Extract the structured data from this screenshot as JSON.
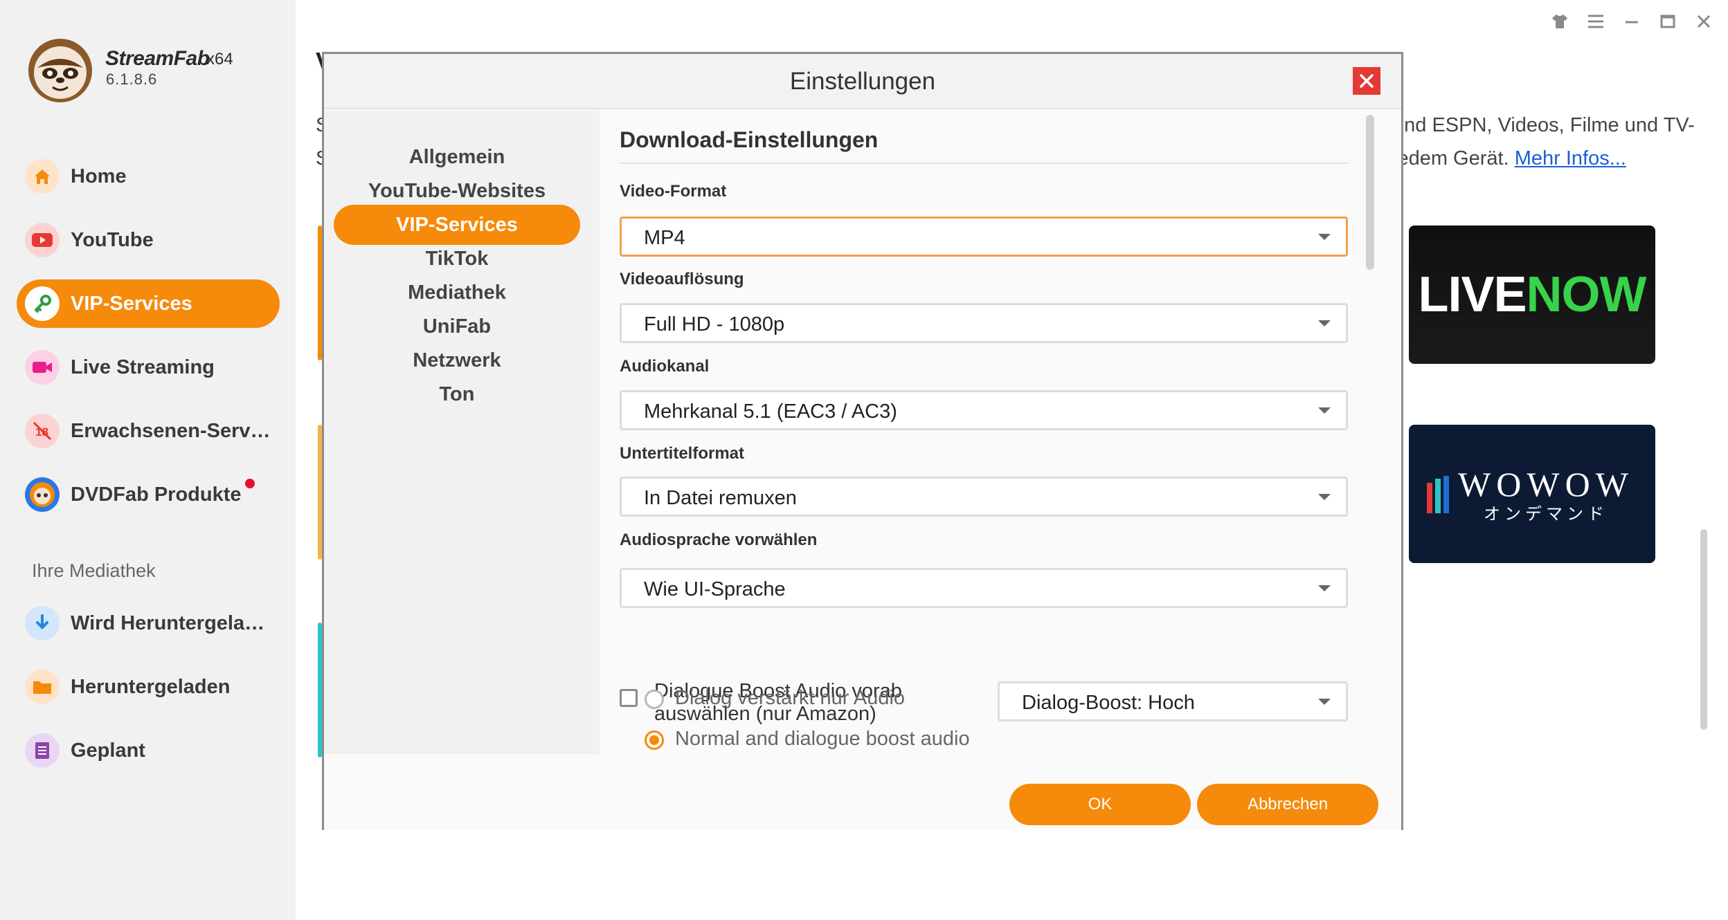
{
  "app": {
    "name": "StreamFab",
    "arch": "x64",
    "version": "6.1.8.6"
  },
  "sidebar": {
    "items": [
      {
        "label": "Home",
        "icon": "home-icon",
        "color": "#f58a0b"
      },
      {
        "label": "YouTube",
        "icon": "youtube-icon",
        "color": "#e53935"
      },
      {
        "label": "VIP-Services",
        "icon": "key-icon",
        "color": "#2e9e3e",
        "active": true
      },
      {
        "label": "Live Streaming",
        "icon": "camera-icon",
        "color": "#e91e8c"
      },
      {
        "label": "Erwachsenen-Serv…",
        "icon": "adult-block-icon",
        "color": "#e53935"
      },
      {
        "label": "DVDFab Produkte",
        "icon": "dvdfab-icon",
        "color": "#1e6fd9"
      }
    ],
    "library_title": "Ihre Mediathek",
    "library_items": [
      {
        "label": "Wird Heruntergela…",
        "icon": "download-icon",
        "color": "#1e88e5"
      },
      {
        "label": "Heruntergeladen",
        "icon": "folder-icon",
        "color": "#f58a0b"
      },
      {
        "label": "Geplant",
        "icon": "schedule-icon",
        "color": "#8e44ad"
      }
    ]
  },
  "background": {
    "text_line_1": "und ESPN, Videos, Filme und TV-",
    "text_line_2": "jedem Gerät.",
    "link_text": "Mehr Infos...",
    "left_letter": "V",
    "left_s1": "S",
    "left_s2": "S",
    "cards": {
      "livenow_a": "LIVE",
      "livenow_b": "NOW",
      "wowow": "WOWOW",
      "wowow_sub": "オンデマンド"
    }
  },
  "modal": {
    "title": "Einstellungen",
    "nav": [
      "Allgemein",
      "YouTube-Websites",
      "VIP-Services",
      "TikTok",
      "Mediathek",
      "UniFab",
      "Netzwerk",
      "Ton"
    ],
    "active_nav": "VIP-Services",
    "section_title": "Download-Einstellungen",
    "fields": {
      "video_format": {
        "label": "Video-Format",
        "value": "MP4"
      },
      "resolution": {
        "label": "Videoauflösung",
        "value": "Full HD - 1080p"
      },
      "audio_channel": {
        "label": "Audiokanal",
        "value": "Mehrkanal 5.1 (EAC3 / AC3)"
      },
      "subtitle_format": {
        "label": "Untertitelformat",
        "value": "In Datei remuxen"
      },
      "audio_language": {
        "label": "Audiosprache vorwählen",
        "value": "Wie UI-Sprache"
      }
    },
    "dialogue_boost": {
      "label": "Dialogue Boost Audio vorab auswählen (nur Amazon)",
      "checked": false,
      "select_value": "Dialog-Boost: Hoch",
      "options": [
        {
          "label": "Dialog verstärkt nur Audio",
          "checked": false
        },
        {
          "label": "Normal and dialogue boost audio",
          "checked": true
        }
      ]
    },
    "ok_label": "OK",
    "cancel_label": "Abbrechen"
  },
  "colors": {
    "accent": "#f58a0b",
    "close": "#e53935"
  }
}
